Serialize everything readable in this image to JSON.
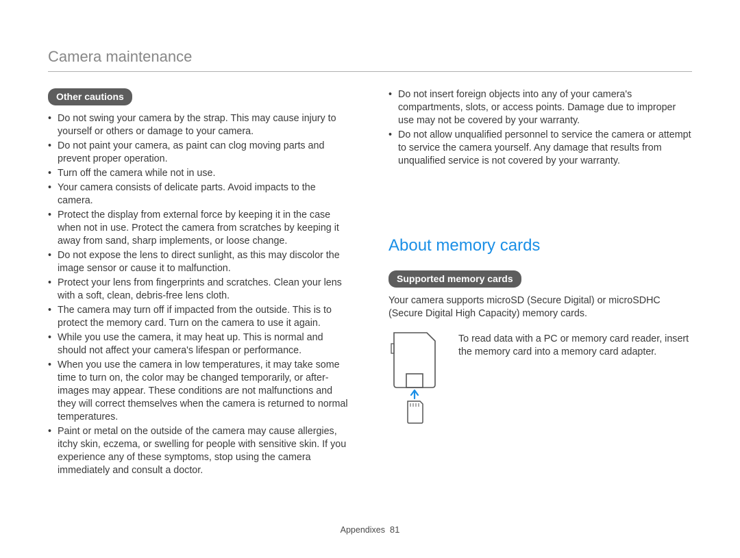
{
  "page_title": "Camera maintenance",
  "left": {
    "pill": "Other cautions",
    "bullets": [
      "Do not swing your camera by the strap. This may cause injury to yourself or others or damage to your camera.",
      "Do not paint your camera, as paint can clog moving parts and prevent proper operation.",
      "Turn off the camera while not in use.",
      "Your camera consists of delicate parts. Avoid impacts to the camera.",
      "Protect the display from external force by keeping it in the case when not in use. Protect the camera from scratches by keeping it away from sand, sharp implements, or loose change.",
      "Do not expose the lens to direct sunlight, as this may discolor the image sensor or cause it to malfunction.",
      "Protect your lens from fingerprints and scratches. Clean your lens with a soft, clean, debris-free lens cloth.",
      "The camera may turn off if impacted from the outside. This is to protect the memory card. Turn on the camera to use it again.",
      "While you use the camera, it may heat up. This is normal and should not affect your camera's lifespan or performance.",
      "When you use the camera in low temperatures, it may take some time to turn on, the color may be changed temporarily, or after-images may appear. These conditions are not malfunctions and they will correct themselves when the camera is returned to normal temperatures.",
      "Paint or metal on the outside of the camera may cause allergies, itchy skin, eczema, or swelling for people with sensitive skin. If you experience any of these symptoms, stop using the camera immediately and consult a doctor."
    ]
  },
  "right": {
    "top_bullets": [
      "Do not insert foreign objects into any of your camera's compartments, slots, or access points. Damage due to improper use may not be covered by your warranty.",
      "Do not allow unqualified personnel to service the camera or attempt to service the camera yourself. Any damage that results from unqualified service is not covered by your warranty."
    ],
    "heading": "About memory cards",
    "pill": "Supported memory cards",
    "paragraph": "Your camera supports microSD (Secure Digital) or microSDHC (Secure Digital High Capacity) memory cards.",
    "adapter_note": "To read data with a PC or memory card reader, insert the memory card into a memory card adapter."
  },
  "footer": {
    "section": "Appendixes",
    "page": "81"
  }
}
